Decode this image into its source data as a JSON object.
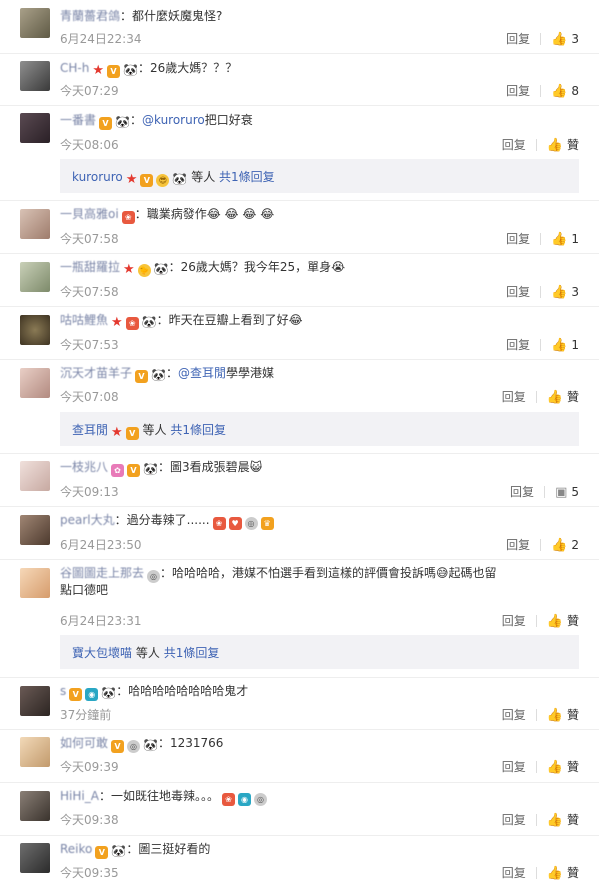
{
  "comments": [
    {
      "user": "青蘭薔君鴿",
      "text": "都什麼妖魔鬼怪?",
      "time": "6月24日22:34",
      "reply": "回复",
      "likes": "3",
      "badges": []
    },
    {
      "user": "CH-h",
      "text": "26歲大媽？？？",
      "time": "今天07:29",
      "reply": "回复",
      "likes": "8",
      "badges": [
        "star",
        "vip",
        "panda"
      ]
    },
    {
      "user": "一番書",
      "mention": "@kuroruro",
      "text": "把口好衰",
      "time": "今天08:06",
      "reply": "回复",
      "likes": "贊",
      "badges": [
        "vip",
        "panda"
      ],
      "sub": {
        "user": "kuroruro",
        "suffix": "等人",
        "more": "共1條回复",
        "badges": [
          "star",
          "vip",
          "emo",
          "panda"
        ]
      }
    },
    {
      "user": "一貝高雅oi",
      "text": "職業病發作😂 😂 😂 😂",
      "time": "今天07:58",
      "reply": "回复",
      "likes": "1",
      "badges": [
        "red"
      ]
    },
    {
      "user": "一瓶甜羅拉",
      "text": "26歲大媽？我今年25，單身😭",
      "time": "今天07:58",
      "reply": "回复",
      "likes": "3",
      "badges": [
        "star",
        "emo",
        "panda"
      ]
    },
    {
      "user": "咕咕鯉魚",
      "text": "昨天在豆瓣上看到了好😂",
      "time": "今天07:53",
      "reply": "回复",
      "likes": "1",
      "badges": [
        "star",
        "red",
        "panda"
      ]
    },
    {
      "user": "沉天才苗羊子",
      "mention": "@查耳閒",
      "text": "學學港媒",
      "time": "今天07:08",
      "reply": "回复",
      "likes": "贊",
      "badges": [
        "vip",
        "panda"
      ],
      "sub": {
        "user": "查耳閒",
        "suffix": "等人",
        "more": "共1條回复",
        "badges": [
          "star",
          "vip"
        ]
      }
    },
    {
      "user": "一枝兆八",
      "text": "圖3看成張碧晨😺",
      "time": "今天09:13",
      "reply": "回复",
      "likes": "5",
      "badges": [
        "red",
        "vip",
        "panda"
      ]
    },
    {
      "user": "pearl大丸",
      "text": "過分毒辣了......",
      "time": "6月24日23:50",
      "reply": "回复",
      "likes": "2",
      "badges": [
        "red",
        "red",
        "emo",
        "vip"
      ]
    },
    {
      "user": "谷圖圖走上那去",
      "text": "哈哈哈哈，港媒不怕選手看到這樣的評價會投訴嗎😅起碼也留",
      "text2": "點口德吧",
      "time": "6月24日23:31",
      "reply": "回复",
      "likes": "贊",
      "badges": [
        "emo"
      ],
      "sub": {
        "user": "寶大包壞喵",
        "suffix": "等人",
        "more": "共1條回复",
        "badges": []
      }
    },
    {
      "user": "s",
      "text": "哈哈哈哈哈哈哈哈鬼才",
      "time": "37分鐘前",
      "reply": "回复",
      "likes": "贊",
      "badges": [
        "vip",
        "cam",
        "panda"
      ]
    },
    {
      "user": "如何可敢",
      "text": "1231766",
      "time": "今天09:39",
      "reply": "回复",
      "likes": "贊",
      "badges": [
        "vip",
        "emo",
        "panda"
      ]
    },
    {
      "user": "HiHi_A",
      "text": "一如既往地毒辣。。。",
      "time": "今天09:38",
      "reply": "回复",
      "likes": "贊",
      "badges": [
        "red",
        "cam",
        "emo"
      ]
    },
    {
      "user": "Reiko",
      "text": "圖三挺好看的",
      "time": "今天09:35",
      "reply": "回复",
      "likes": "贊",
      "badges": [
        "vip",
        "panda"
      ]
    }
  ],
  "colors": {
    "mention": "#3f64b4",
    "time": "#999999",
    "subbox": "#f2f2f5"
  }
}
